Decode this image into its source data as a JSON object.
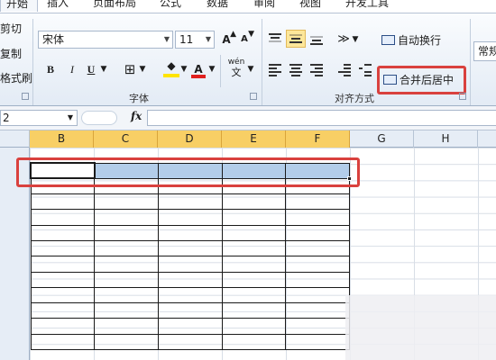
{
  "menu": {
    "tabs": [
      "开始",
      "插入",
      "页面布局",
      "公式",
      "数据",
      "审阅",
      "视图",
      "开发工具"
    ],
    "active": "开始"
  },
  "clipboard": {
    "cut": "剪切",
    "copy": "复制",
    "painter": "格式刷"
  },
  "font": {
    "name": "宋体",
    "size": "11",
    "grow": "A",
    "shrink": "A",
    "bold": "B",
    "italic": "I",
    "underline": "U",
    "color_letter": "A",
    "wen": "wén",
    "group_label": "字体"
  },
  "alignment": {
    "wrap_text": "自动换行",
    "merge_center": "合并后居中",
    "group_label": "对齐方式"
  },
  "number": {
    "format": "常规"
  },
  "formula_bar": {
    "name_box": "2",
    "fx": "fx",
    "formula": ""
  },
  "grid": {
    "columns": [
      "B",
      "C",
      "D",
      "E",
      "F",
      "G",
      "H"
    ],
    "selected_columns": [
      "B",
      "C",
      "D",
      "E",
      "F"
    ]
  },
  "colors": {
    "highlight": "#d9413e",
    "selection": "#b3cde9",
    "header_selected": "#f8cf65"
  }
}
